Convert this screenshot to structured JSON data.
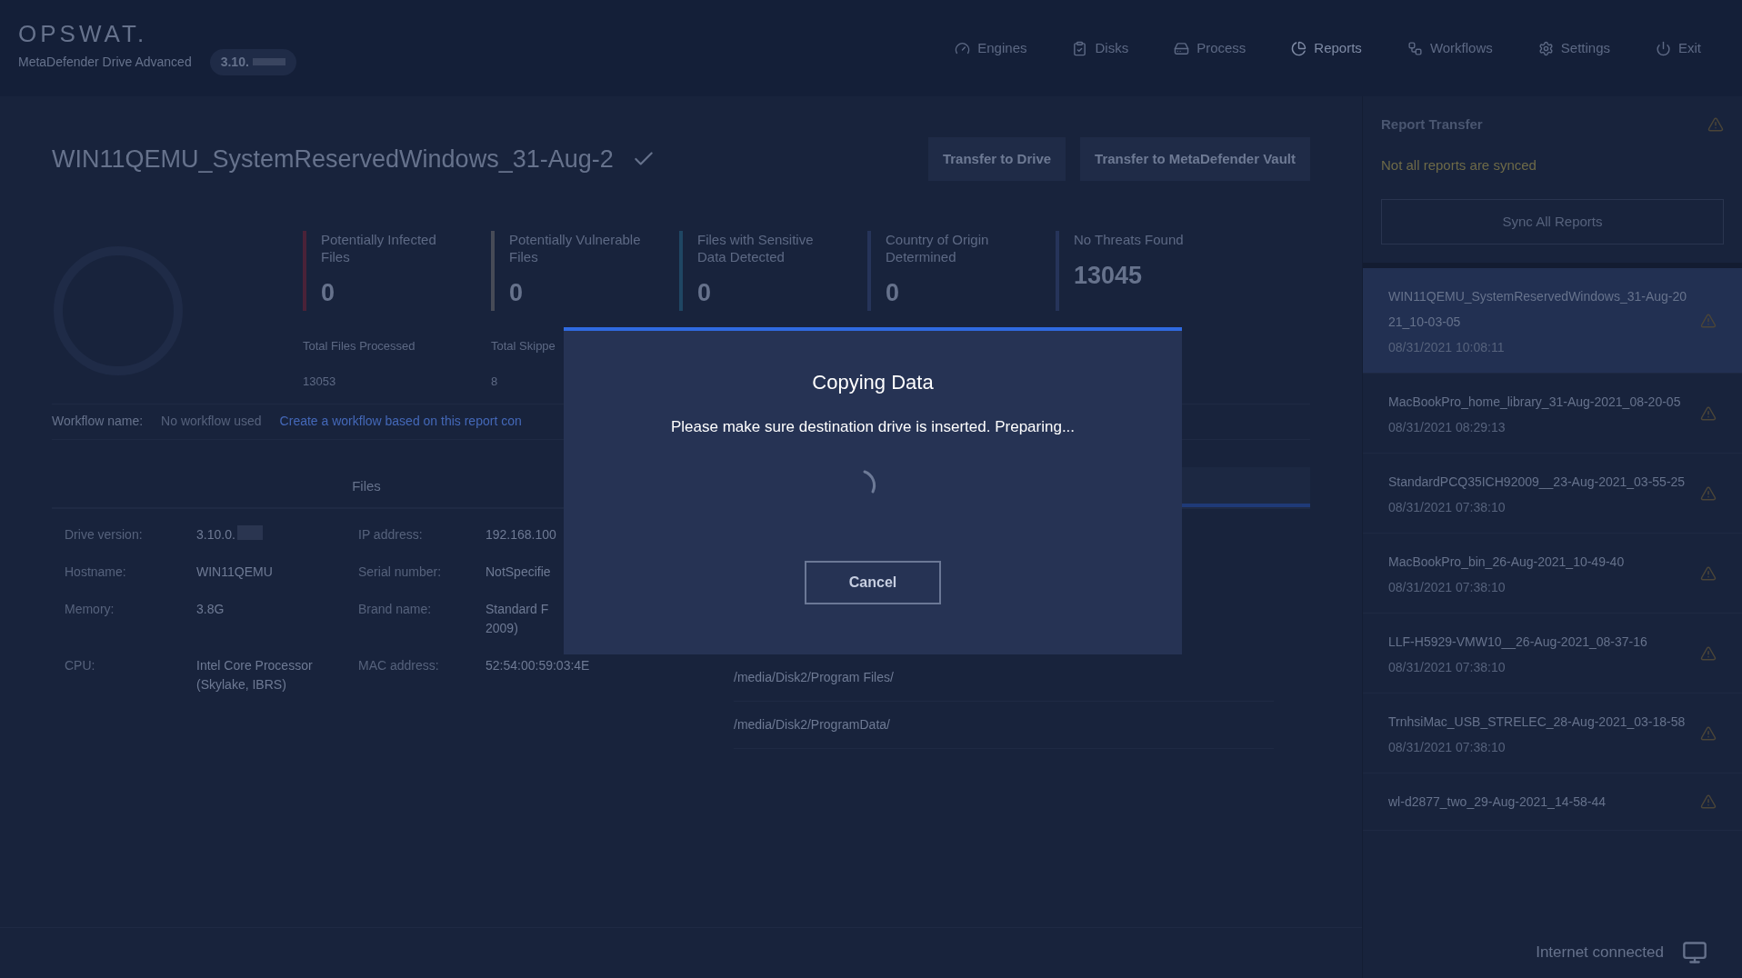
{
  "header": {
    "logo": "OPSWAT.",
    "product": "MetaDefender Drive Advanced",
    "version": "3.10.",
    "nav": [
      {
        "kind": "engines",
        "label": "Engines",
        "selected": false
      },
      {
        "kind": "disks",
        "label": "Disks",
        "selected": false
      },
      {
        "kind": "process",
        "label": "Process",
        "selected": false
      },
      {
        "kind": "reports",
        "label": "Reports",
        "selected": true
      },
      {
        "kind": "workflows",
        "label": "Workflows",
        "selected": false
      },
      {
        "kind": "settings",
        "label": "Settings",
        "selected": false
      },
      {
        "kind": "exit",
        "label": "Exit",
        "selected": false
      }
    ]
  },
  "report": {
    "title": "WIN11QEMU_SystemReservedWindows_31-Aug-2",
    "actions": [
      "Transfer to Drive",
      "Transfer to MetaDefender Vault"
    ],
    "stats": [
      {
        "label": "Potentially Infected Files",
        "value": "0",
        "color": "#4a2238"
      },
      {
        "label": "Potentially Vulnerable Files",
        "value": "0",
        "color": "#474b57"
      },
      {
        "label": "Files with Sensitive Data Detected",
        "value": "0",
        "color": "#1f4663"
      },
      {
        "label": "Country of Origin Determined",
        "value": "0",
        "color": "#26345a"
      },
      {
        "label": "No Threats Found",
        "value": "13045",
        "color": "#26345a"
      }
    ],
    "totals": [
      {
        "label": "Total Files Processed",
        "value": "13053"
      },
      {
        "label": "Total Skippe",
        "value": "8"
      }
    ],
    "workflow": {
      "label": "Workflow name:",
      "value": "No workflow used",
      "link": "Create a workflow based on this report con"
    },
    "tabs": [
      {
        "label": "Files",
        "selected": false
      },
      {
        "selected": true
      }
    ],
    "info": [
      {
        "label": "Drive version:",
        "value": "3.10.0.",
        "redacted": true
      },
      {
        "label": "IP address:",
        "value": "192.168.100"
      },
      {
        "label": "Hostname:",
        "value": "WIN11QEMU"
      },
      {
        "label": "Serial number:",
        "value": "NotSpecifie"
      },
      {
        "label": "Memory:",
        "value": "3.8G"
      },
      {
        "label": "Brand name:",
        "value": "Standard F\n2009)"
      },
      {
        "label": "CPU:",
        "value": "Intel Core Processor\n(Skylake, IBRS)"
      },
      {
        "label": "MAC address:",
        "value": "52:54:00:59:03:4E"
      }
    ],
    "paths": [
      "/media/Disk2/Program Files/",
      "/media/Disk2/ProgramData/"
    ]
  },
  "sidebar": {
    "title": "Report Transfer",
    "warning": "Not all reports are synced",
    "sync_button": "Sync All Reports",
    "reports": [
      {
        "name": "WIN11QEMU_SystemReservedWindows_31-Aug-2021_10-03-05",
        "time": "08/31/2021 10:08:11",
        "selected": true
      },
      {
        "name": "MacBookPro_home_library_31-Aug-2021_08-20-05",
        "time": "08/31/2021 08:29:13",
        "selected": false
      },
      {
        "name": "StandardPCQ35ICH92009__23-Aug-2021_03-55-25",
        "time": "08/31/2021 07:38:10",
        "selected": false
      },
      {
        "name": "MacBookPro_bin_26-Aug-2021_10-49-40",
        "time": "08/31/2021 07:38:10",
        "selected": false
      },
      {
        "name": "LLF-H5929-VMW10__26-Aug-2021_08-37-16",
        "time": "08/31/2021 07:38:10",
        "selected": false
      },
      {
        "name": "TrnhsiMac_USB_STRELEC_28-Aug-2021_03-18-58",
        "time": "08/31/2021 07:38:10",
        "selected": false
      },
      {
        "name": "wl-d2877_two_29-Aug-2021_14-58-44",
        "selected": false
      }
    ],
    "status": "Internet connected"
  },
  "dialog": {
    "title": "Copying Data",
    "message": "Please make sure destination drive is inserted. Preparing...",
    "cancel": "Cancel"
  }
}
